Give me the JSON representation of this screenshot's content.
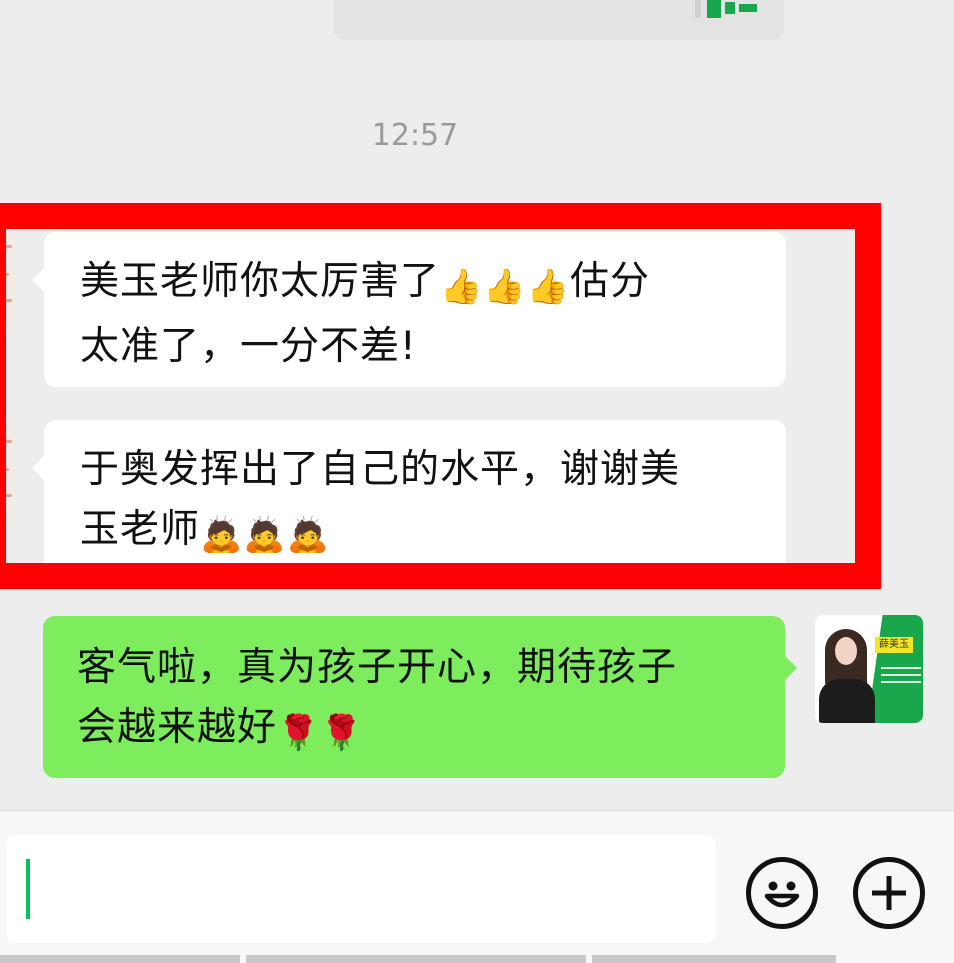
{
  "chat": {
    "timestamp": "12:57",
    "messages": [
      {
        "direction": "incoming",
        "text_line1": "美玉老师你太厉害了",
        "emojis_a": [
          "👍",
          "👍",
          "👍"
        ],
        "text_line1_end": "估分",
        "text_line2": "太准了，一分不差!"
      },
      {
        "direction": "incoming",
        "text_line1": "于奥发挥出了自己的水平，谢谢美",
        "text_line2": "玉老师",
        "emojis_b": [
          "🙇",
          "🙇",
          "🙇"
        ]
      },
      {
        "direction": "outgoing",
        "text_line1": "客气啦，真为孩子开心，期待孩子",
        "text_line2": "会越来越好",
        "emojis_c": [
          "🌹",
          "🌹"
        ]
      }
    ],
    "my_avatar": {
      "name_tag": "薛美玉"
    }
  },
  "input_bar": {
    "value": "",
    "placeholder": "",
    "emoji_button": "smiley-icon",
    "plus_button": "plus-icon"
  },
  "colors": {
    "background": "#ededed",
    "incoming_bubble": "#ffffff",
    "outgoing_bubble": "#7ded5d",
    "highlight_border": "#ff0000",
    "caret": "#07c160"
  }
}
